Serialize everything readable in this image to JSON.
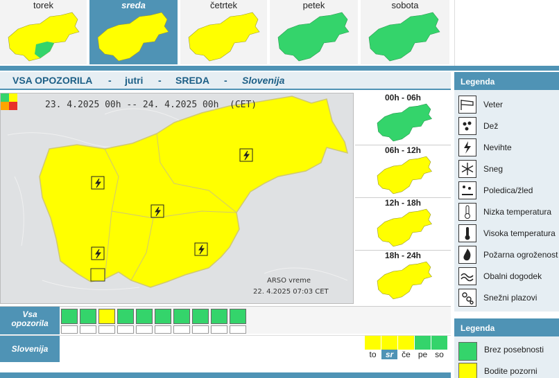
{
  "days": [
    {
      "label": "torek",
      "active": false
    },
    {
      "label": "sreda",
      "active": true
    },
    {
      "label": "četrtek",
      "active": false
    },
    {
      "label": "petek",
      "active": false
    },
    {
      "label": "sobota",
      "active": false
    }
  ],
  "header": {
    "part1": "VSA OPOZORILA",
    "dash1": "-",
    "part2": "jutri",
    "dash2": "-",
    "part3": "SREDA",
    "dash3": "-",
    "part4": "Slovenija"
  },
  "map": {
    "validity": "23. 4.2025  00h  --  24. 4.2025  00h",
    "tz": "(CET)",
    "credit": "ARSO vreme",
    "issued": "22. 4.2025  07:03 CET"
  },
  "periods": [
    "00h - 06h",
    "06h - 12h",
    "12h - 18h",
    "18h - 24h"
  ],
  "rows": {
    "warnings_label_1": "Vsa",
    "warnings_label_2": "opozorila",
    "region_label": "Slovenija"
  },
  "day_abbrev": [
    "to",
    "sr",
    "če",
    "pe",
    "so"
  ],
  "legend": {
    "title": "Legenda",
    "items": [
      {
        "label": "Veter",
        "icon": "wind-icon"
      },
      {
        "label": "Dež",
        "icon": "rain-icon"
      },
      {
        "label": "Nevihte",
        "icon": "thunderstorm-icon"
      },
      {
        "label": "Sneg",
        "icon": "snow-icon"
      },
      {
        "label": "Poledica/žled",
        "icon": "ice-icon"
      },
      {
        "label": "Nizka temperatura",
        "icon": "low-temp-icon"
      },
      {
        "label": "Visoka temperatura",
        "icon": "high-temp-icon"
      },
      {
        "label": "Požarna ogroženost",
        "icon": "fire-icon"
      },
      {
        "label": "Obalni dogodek",
        "icon": "coastal-icon"
      },
      {
        "label": "Snežni plazovi",
        "icon": "avalanche-icon"
      }
    ],
    "title2": "Legenda",
    "levels": [
      {
        "label": "Brez posebnosti",
        "color": "#34d46b"
      },
      {
        "label": "Bodite pozorni",
        "color": "#ffff00"
      }
    ]
  },
  "colors": {
    "green": "#34d46b",
    "yellow": "#ffff00",
    "accent": "#4f93b5"
  }
}
